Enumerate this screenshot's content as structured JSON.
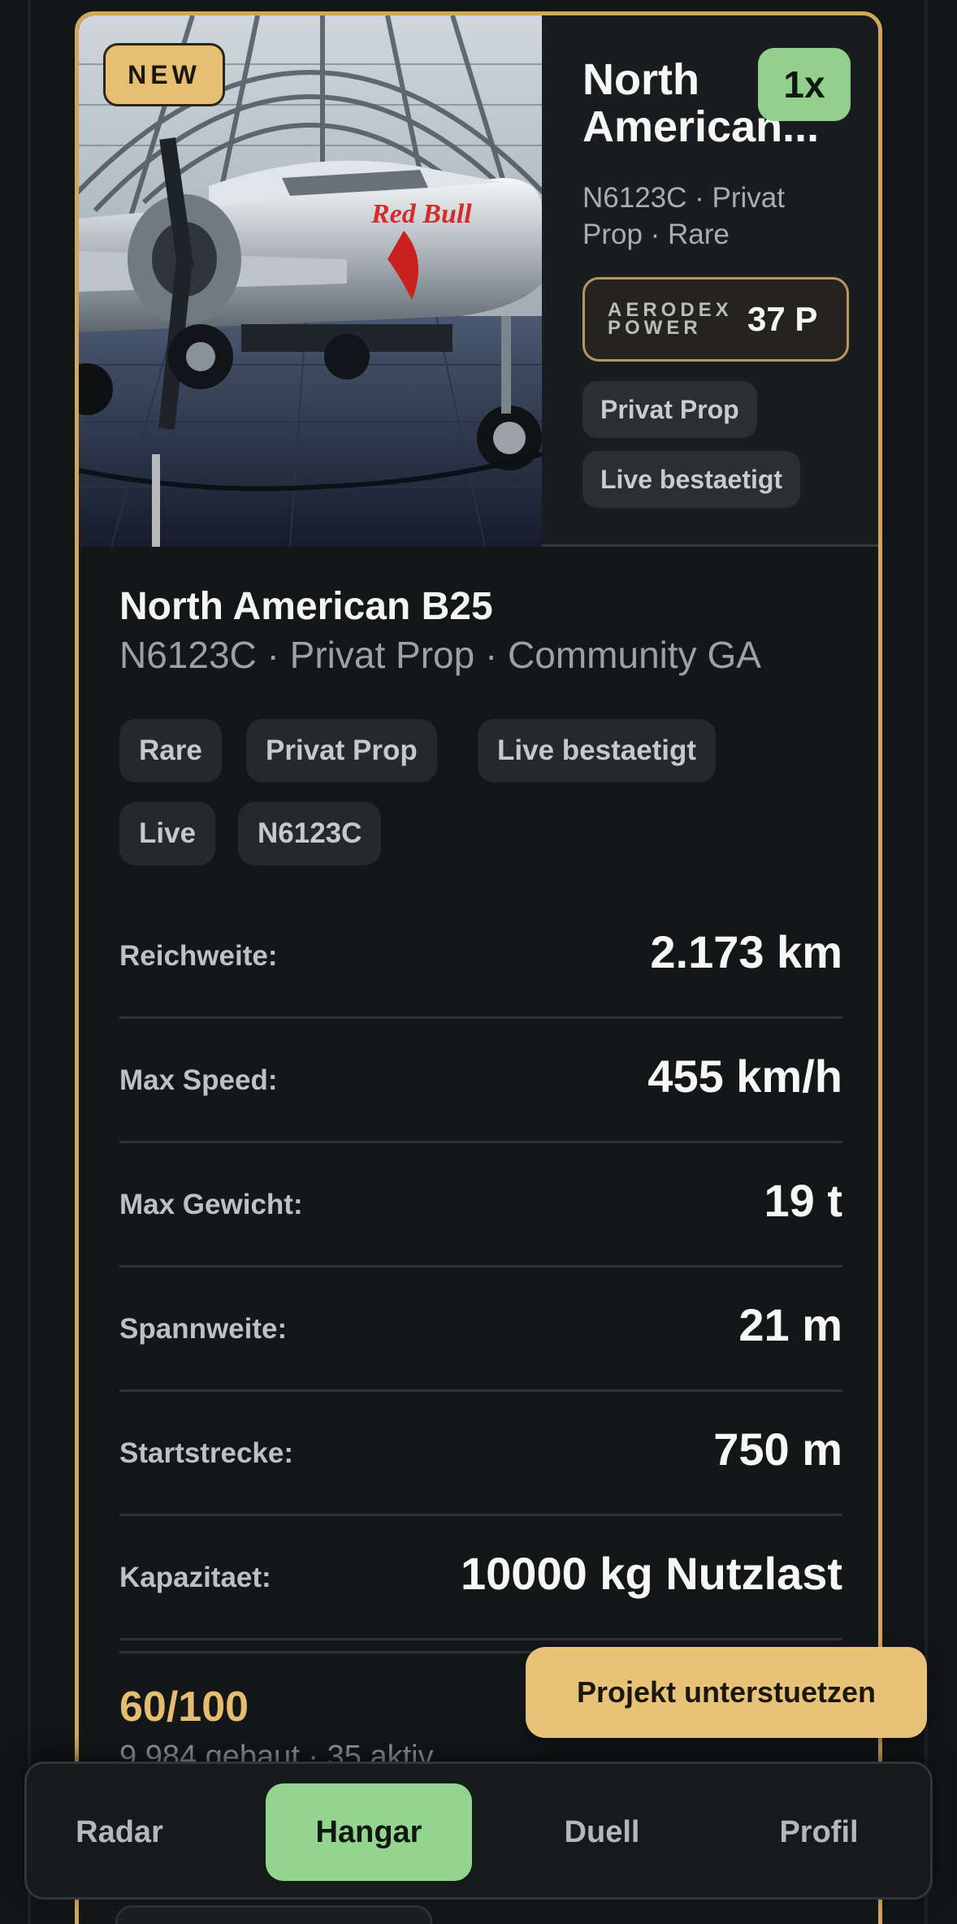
{
  "colors": {
    "accent_gold": "#d2a65b",
    "active_green": "#93d58f",
    "background": "#121516"
  },
  "card": {
    "badge_new": "NEW",
    "count_badge": "1x",
    "title_short_line1": "North",
    "title_short_line2": "American...",
    "meta_top": "N6123C · Privat Prop · Rare",
    "power_label": "AERODEX POWER",
    "power_value": "37 P",
    "chips": [
      "Privat Prop",
      "Live bestaetigt"
    ],
    "title": "North American B25",
    "subtitle": "N6123C · Privat Prop · Community GA",
    "tags": [
      "Rare",
      "Privat Prop",
      "Live bestaetigt",
      "Live",
      "N6123C"
    ],
    "stats": [
      {
        "label": "Reichweite:",
        "value": "2.173 km"
      },
      {
        "label": "Max Speed:",
        "value": "455 km/h"
      },
      {
        "label": "Max Gewicht:",
        "value": "19 t"
      },
      {
        "label": "Spannweite:",
        "value": "21 m"
      },
      {
        "label": "Startstrecke:",
        "value": "750 m"
      },
      {
        "label": "Kapazitaet:",
        "value": "10000 kg Nutzlast"
      }
    ],
    "score": "60/100",
    "built_info": "9.984 gebaut · 35 aktiv"
  },
  "support_button": "Projekt unterstuetzen",
  "nav": {
    "items": [
      "Radar",
      "Hangar",
      "Duell",
      "Profil"
    ],
    "active": "Hangar"
  },
  "hero_image": {
    "subject": "silver propeller airplane in glass dome hangar",
    "logo_text": "Red Bull"
  }
}
